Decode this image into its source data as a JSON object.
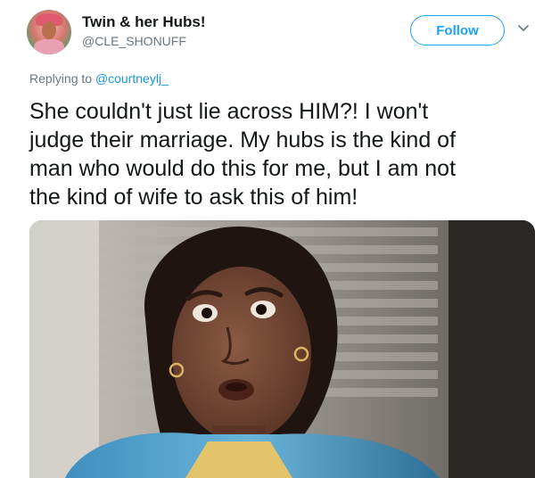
{
  "author": {
    "display_name": "Twin & her Hubs!",
    "handle": "@CLE_SHONUFF",
    "avatar_icon": "profile-avatar"
  },
  "actions": {
    "follow_label": "Follow",
    "more_icon": "chevron-down-icon"
  },
  "reply": {
    "prefix": "Replying to ",
    "mention": "@courtneylj_"
  },
  "tweet": {
    "lines": [
      "She couldn't just lie across HIM?! I won't",
      "judge their marriage. My hubs is the kind of",
      "man who would do this for me, but I am not",
      "the kind of wife to ask this of him!"
    ]
  },
  "media": {
    "type": "image",
    "subject": "woman-reaction-image"
  },
  "colors": {
    "accent": "#1da1f2",
    "mention": "#1b95e0",
    "secondary_text": "#657786",
    "primary_text": "#14171a"
  }
}
